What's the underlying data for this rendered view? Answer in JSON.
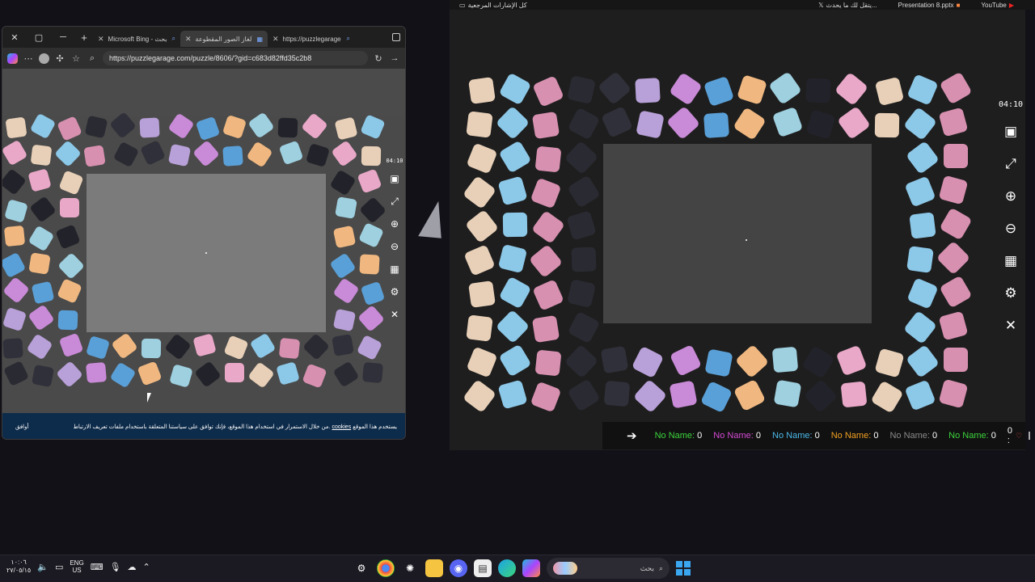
{
  "left_window": {
    "tabs": [
      {
        "label": "Microsoft Bing - بحث",
        "active": false
      },
      {
        "label": "ألغاز الصور المقطوعة",
        "active": true
      },
      {
        "label": "https://puzzlegarage",
        "active": false
      }
    ],
    "window_controls": {
      "close": "✕",
      "maximize": "▢",
      "minimize": "─"
    },
    "url": "https://puzzlegarage.com/puzzle/8606/?gid=c683d82ffd35c2b8",
    "timer": "04:10",
    "cookie_bar": {
      "accept_label": "أوافق",
      "text_before": "يستخدم هذا الموقع",
      "link": "cookies",
      "text_after": "من خلال الاستمرار في استخدام هذا الموقع، فإنك توافق على سياستنا المتعلقة باستخدام ملفات تعريف الارتباط."
    }
  },
  "bookmarks_bar": {
    "all_bookmarks": "كل الإشارات المرجعية",
    "items": [
      "يتقل لك ما يحدث...",
      "Presentation 8.pptx",
      "YouTube"
    ]
  },
  "right_window": {
    "timer": "04:10",
    "scores": [
      {
        "name": "No Name:",
        "value": "0",
        "color": "#3cd43c"
      },
      {
        "name": "No Name:",
        "value": "0",
        "color": "#d44ad4"
      },
      {
        "name": "No Name:",
        "value": "0",
        "color": "#4ab8e8"
      },
      {
        "name": "No Name:",
        "value": "0",
        "color": "#f0a020"
      },
      {
        "name": "No Name:",
        "value": "0",
        "color": "#8a8a8a"
      },
      {
        "name": "No Name:",
        "value": "0",
        "color": "#3cd43c"
      }
    ],
    "last_score": "0 :"
  },
  "taskbar": {
    "time": "١٠:٠٦",
    "date": "٢٧/٠٥/١٥",
    "lang_top": "ENG",
    "lang_bottom": "US",
    "search_label": "بحث"
  },
  "colors": {
    "accent": "#3aa7f0",
    "cookie_bar": "#0d2b4a"
  }
}
